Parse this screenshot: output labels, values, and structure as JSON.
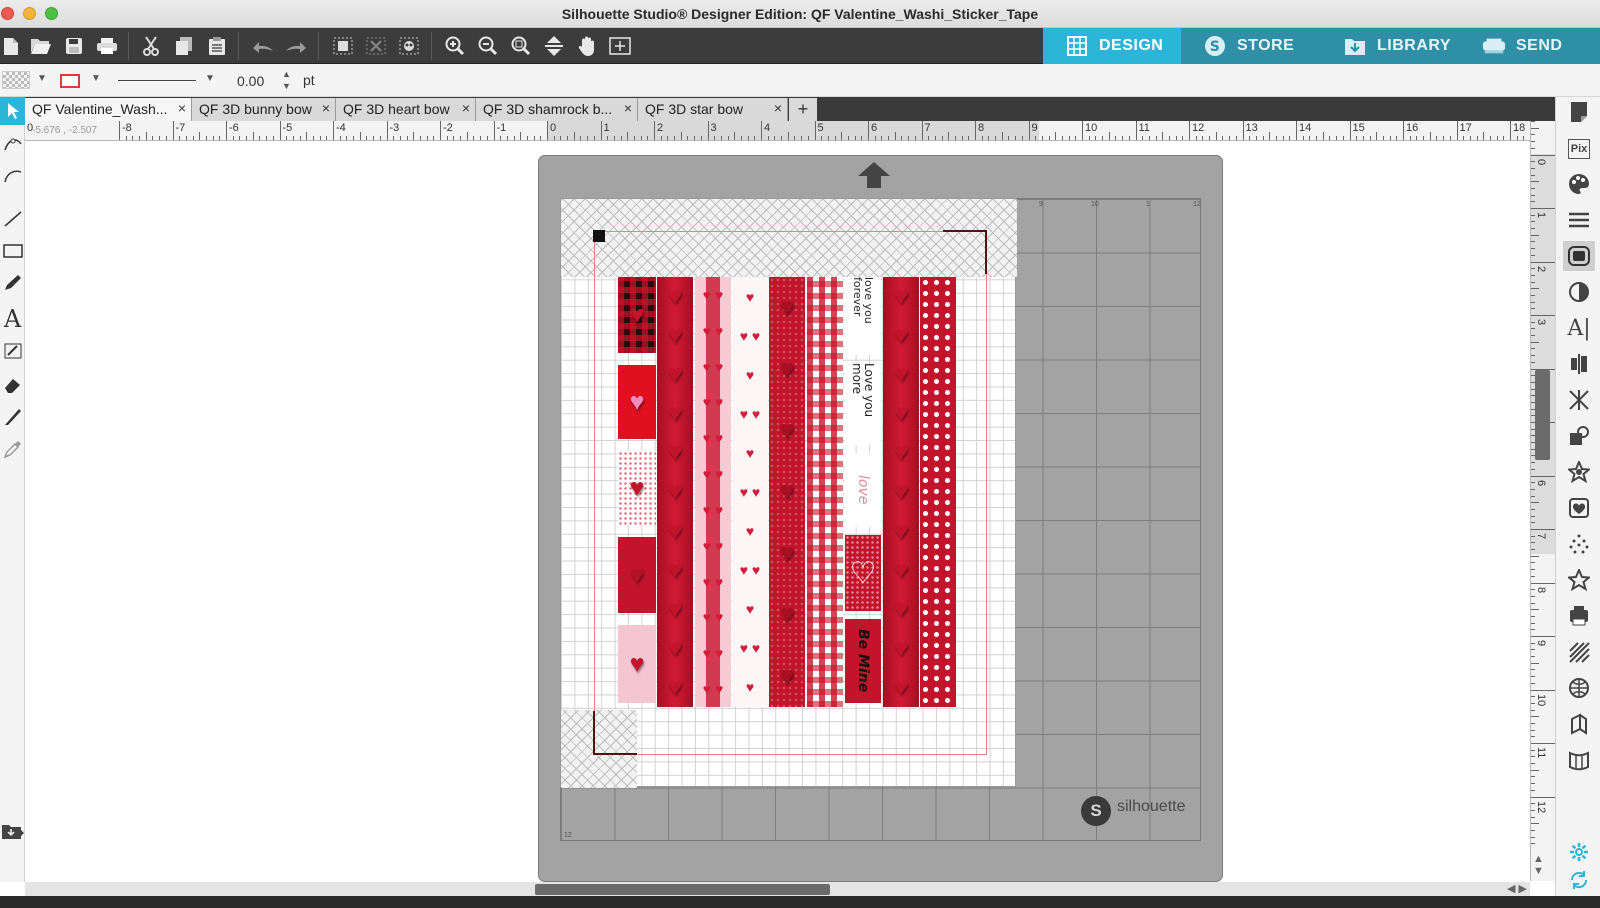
{
  "window": {
    "title": "Silhouette Studio® Designer Edition: QF Valentine_Washi_Sticker_Tape"
  },
  "nav": {
    "design": "DESIGN",
    "store": "STORE",
    "library": "LIBRARY",
    "send": "SEND",
    "active": "design"
  },
  "property_bar": {
    "line_width": "0.00",
    "line_unit": "pt",
    "stroke_color": "#e03a3a"
  },
  "tabs": [
    {
      "label": "QF Valentine_Wash..."
    },
    {
      "label": "QF 3D bunny bow"
    },
    {
      "label": "QF 3D heart bow"
    },
    {
      "label": "QF 3D shamrock b..."
    },
    {
      "label": "QF 3D star bow"
    }
  ],
  "ruler": {
    "h_labels": [
      "-8",
      "-7",
      "-6",
      "-5",
      "-4",
      "-3",
      "-2",
      "-1",
      "0",
      "1",
      "2",
      "3",
      "4",
      "5",
      "6",
      "7",
      "8",
      "9",
      "10",
      "11",
      "12",
      "13",
      "14",
      "15",
      "16",
      "17",
      "18"
    ],
    "v_labels": [
      "1",
      "0",
      "1",
      "2",
      "3",
      "4",
      "5",
      "6",
      "7",
      "8",
      "9",
      "10",
      "11",
      "12"
    ],
    "h_zero_label": "0",
    "cursor_readout": "-5.676 , -2.507"
  },
  "mat": {
    "brand": "silhouette",
    "logo_letter": "S",
    "grid_labels": {
      "top_9": "9",
      "top_10": "10",
      "top_11": "1",
      "top_12": "12",
      "bottom_12": "12"
    }
  },
  "design_text": {
    "love_you_forever": "love you forever",
    "love_you_more": "Love you more",
    "love": "love",
    "be_mine": "Be Mine"
  },
  "colors": {
    "accent": "#2bb5d9",
    "nav_inactive": "#2e8fa7",
    "washi_red": "#c2152c",
    "cut_line": "#ef8080"
  },
  "icons": {
    "file": [
      "new-file-icon",
      "open-file-icon",
      "save-icon",
      "print-icon"
    ],
    "edit": [
      "cut-icon",
      "copy-icon",
      "paste-icon",
      "undo-icon",
      "redo-icon"
    ],
    "select": [
      "select-all-icon",
      "deselect-icon",
      "select-by-color-icon"
    ],
    "view": [
      "zoom-in-icon",
      "zoom-out-icon",
      "zoom-fit-icon",
      "fit-to-page-icon",
      "pan-icon",
      "add-page-icon"
    ]
  }
}
